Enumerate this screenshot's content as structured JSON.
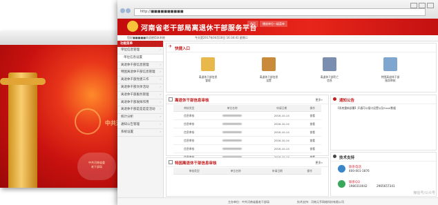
{
  "back_window": {
    "title": "中共河南",
    "login_text": "中共河南省委\n老干部局",
    "colors": {
      "screen": "#c9120f",
      "pillar": "#e5b43a"
    }
  },
  "browser": {
    "address": "http://■■■■■■■■■■",
    "nav_icons": [
      "back-icon",
      "forward-icon",
      "refresh-icon"
    ]
  },
  "header": {
    "title": "河南省老干部局离退休干部服务平台",
    "tabs": [
      "首页",
      "播放单位一级菜单"
    ],
    "accent": "#c41b1b"
  },
  "infobar": {
    "welcome": "您好■■■■■欢迎使用本系统",
    "date": "今天是2017年04月18日 16:34:41 星期二"
  },
  "sidebar": {
    "header": "功能菜单",
    "items": [
      {
        "label": "单位信息管理",
        "sub": false
      },
      {
        "label": "单位信息设置",
        "sub": true
      },
      {
        "label": "离退休干部信息管理",
        "sub": false
      },
      {
        "label": "特困离退休干部信息管理",
        "sub": false
      },
      {
        "label": "离退休干部党建工作",
        "sub": false
      },
      {
        "label": "离退休干部文体活动",
        "sub": false
      },
      {
        "label": "离退休干部服务管理",
        "sub": false
      },
      {
        "label": "离退休干部发挥作用",
        "sub": false
      },
      {
        "label": "离退休干部是是是是活动",
        "sub": false
      },
      {
        "label": "统计分析",
        "sub": false
      },
      {
        "label": "通知公告管理",
        "sub": false
      },
      {
        "label": "系统设置",
        "sub": false
      }
    ]
  },
  "quick": {
    "title": "快捷入口",
    "items": [
      {
        "label": "离退休干部信息\n管理",
        "icon": "folder-icon",
        "color": "#e8b94a"
      },
      {
        "label": "离退休干部信息\n设置",
        "icon": "notebook-icon",
        "color": "#c98a3a"
      },
      {
        "label": "离退休干部死亡\n信息",
        "icon": "people-icon",
        "color": "#7a8fb0"
      },
      {
        "label": "特困离退休干部\n服务审核",
        "icon": "magnifier-icon",
        "color": "#7fa6cf"
      }
    ]
  },
  "audit": {
    "title": "离退休干部信息审核",
    "more": "更多»",
    "columns": [
      "审核类型",
      "单位名称",
      "申请日期",
      "操作"
    ],
    "rows": [
      [
        "信息审核",
        "",
        "2016-10-14",
        "查看"
      ],
      [
        "信息审核",
        "",
        "2016-10-14",
        "查看"
      ],
      [
        "信息审核",
        "",
        "2016-10-14",
        "查看"
      ],
      [
        "信息审核",
        "",
        "2016-10-14",
        "查看"
      ],
      [
        "信息审核",
        "",
        "2016-10-14",
        "查看"
      ],
      [
        "信息审核",
        "",
        "2016-10-14",
        "查看"
      ]
    ]
  },
  "notice": {
    "title": "通知公告",
    "more": "更多»",
    "items": [
      "【系统重新部署】开通可以接口设置以及Excel数据"
    ]
  },
  "poor_audit": {
    "title": "特困离退休干部信息审核",
    "more": "更多»",
    "columns": [
      "审核类型",
      "单位名称",
      "申请日期",
      "操作"
    ]
  },
  "support": {
    "title": "技术支持",
    "contacts": [
      {
        "name": "联系电话",
        "value": "400-001-1876",
        "color": "#3a86c8"
      },
      {
        "name": "联系QQ",
        "value": "1980310042",
        "value2": "2965657341",
        "color": "#3aa85a"
      }
    ]
  },
  "footer": {
    "sponsor": "主办单位：中共河南省委老干部局",
    "tech": "技术支持：河南元亨网络科技有限公司"
  },
  "watermark": "微信号/公众号"
}
